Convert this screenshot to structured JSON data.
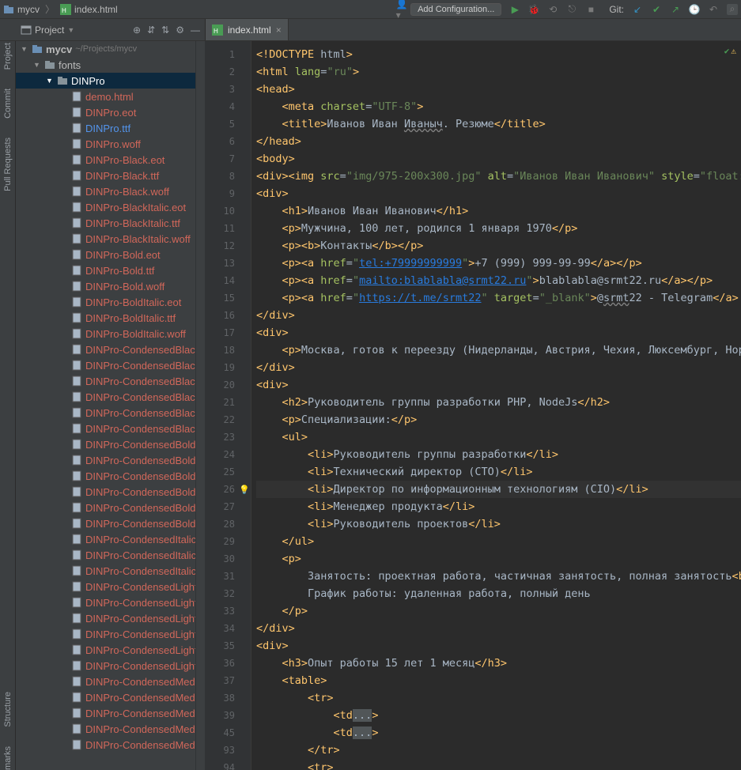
{
  "navbar": {
    "crumb1": "mycv",
    "crumb2": "index.html",
    "add_config": "Add Configuration...",
    "git_label": "Git:"
  },
  "toolwindow": {
    "project_label": "Project"
  },
  "rail": {
    "project": "Project",
    "commit": "Commit",
    "pull": "Pull Requests",
    "structure": "Structure",
    "marks": "marks"
  },
  "editor_tab": {
    "label": "index.html"
  },
  "tree": {
    "root_name": "mycv",
    "root_path": "~/Projects/mycv",
    "fonts": "fonts",
    "dinpro": "DINPro",
    "files": [
      {
        "name": "demo.html",
        "cls": "orange"
      },
      {
        "name": "DINPro.eot",
        "cls": "orange"
      },
      {
        "name": "DINPro.ttf",
        "cls": "blue"
      },
      {
        "name": "DINPro.woff",
        "cls": "orange"
      },
      {
        "name": "DINPro-Black.eot",
        "cls": "orange"
      },
      {
        "name": "DINPro-Black.ttf",
        "cls": "orange"
      },
      {
        "name": "DINPro-Black.woff",
        "cls": "orange"
      },
      {
        "name": "DINPro-BlackItalic.eot",
        "cls": "orange"
      },
      {
        "name": "DINPro-BlackItalic.ttf",
        "cls": "orange"
      },
      {
        "name": "DINPro-BlackItalic.woff",
        "cls": "orange"
      },
      {
        "name": "DINPro-Bold.eot",
        "cls": "orange"
      },
      {
        "name": "DINPro-Bold.ttf",
        "cls": "orange"
      },
      {
        "name": "DINPro-Bold.woff",
        "cls": "orange"
      },
      {
        "name": "DINPro-BoldItalic.eot",
        "cls": "orange"
      },
      {
        "name": "DINPro-BoldItalic.ttf",
        "cls": "orange"
      },
      {
        "name": "DINPro-BoldItalic.woff",
        "cls": "orange"
      },
      {
        "name": "DINPro-CondensedBlack.eot",
        "cls": "orange"
      },
      {
        "name": "DINPro-CondensedBlack.ttf",
        "cls": "orange"
      },
      {
        "name": "DINPro-CondensedBlack.woff",
        "cls": "orange"
      },
      {
        "name": "DINPro-CondensedBlackItalic.eot",
        "cls": "orange"
      },
      {
        "name": "DINPro-CondensedBlackItalic.ttf",
        "cls": "orange"
      },
      {
        "name": "DINPro-CondensedBlackItalic.woff",
        "cls": "orange"
      },
      {
        "name": "DINPro-CondensedBold.eot",
        "cls": "orange"
      },
      {
        "name": "DINPro-CondensedBold.ttf",
        "cls": "orange"
      },
      {
        "name": "DINPro-CondensedBold.woff",
        "cls": "orange"
      },
      {
        "name": "DINPro-CondensedBoldItalic.eot",
        "cls": "orange"
      },
      {
        "name": "DINPro-CondensedBoldItalic.ttf",
        "cls": "orange"
      },
      {
        "name": "DINPro-CondensedBoldItalic.woff",
        "cls": "orange"
      },
      {
        "name": "DINPro-CondensedItalic.eot",
        "cls": "orange"
      },
      {
        "name": "DINPro-CondensedItalic.ttf",
        "cls": "orange"
      },
      {
        "name": "DINPro-CondensedItalic.woff",
        "cls": "orange"
      },
      {
        "name": "DINPro-CondensedLight.eot",
        "cls": "orange"
      },
      {
        "name": "DINPro-CondensedLight.ttf",
        "cls": "orange"
      },
      {
        "name": "DINPro-CondensedLight.woff",
        "cls": "orange"
      },
      {
        "name": "DINPro-CondensedLightItalic.eot",
        "cls": "orange"
      },
      {
        "name": "DINPro-CondensedLightItalic.ttf",
        "cls": "orange"
      },
      {
        "name": "DINPro-CondensedLightItalic.woff",
        "cls": "orange"
      },
      {
        "name": "DINPro-CondensedMedium.eot",
        "cls": "orange"
      },
      {
        "name": "DINPro-CondensedMedium.ttf",
        "cls": "orange"
      },
      {
        "name": "DINPro-CondensedMedium.woff",
        "cls": "orange"
      },
      {
        "name": "DINPro-CondensedMediumItalic.eot",
        "cls": "orange"
      },
      {
        "name": "DINPro-CondensedMediumItalic.ttf",
        "cls": "orange"
      }
    ]
  },
  "gutter_lines": [
    "1",
    "2",
    "3",
    "4",
    "5",
    "6",
    "7",
    "8",
    "9",
    "10",
    "11",
    "12",
    "13",
    "14",
    "15",
    "16",
    "17",
    "18",
    "19",
    "20",
    "21",
    "22",
    "23",
    "24",
    "25",
    "26",
    "27",
    "28",
    "29",
    "30",
    "31",
    "32",
    "33",
    "34",
    "35",
    "36",
    "37",
    "38",
    "39",
    "45",
    "93",
    "94"
  ],
  "code": {
    "l1": {
      "a": "<!DOCTYPE ",
      "b": "html",
      "c": ">"
    },
    "l2": {
      "a": "<html ",
      "b": "lang",
      "c": "=",
      "d": "\"ru\"",
      "e": ">"
    },
    "l3": "<head>",
    "l4": {
      "a": "    <meta ",
      "b": "charset",
      "c": "=",
      "d": "\"UTF-8\"",
      "e": ">"
    },
    "l5": {
      "a": "    <title>",
      "b": "Иванов Иван ",
      "c": "Иваныч",
      "d": ". Резюме",
      "e": "</title>"
    },
    "l6": "</head>",
    "l7": "<body>",
    "l8": {
      "a": "<div><img ",
      "b": "src",
      "c": "=",
      "d": "\"img/975-200x300.jpg\"",
      "e": " alt",
      "f": "=",
      "g": "\"Иванов Иван Иванович\"",
      "h": " style",
      "i": "=",
      "j": "\"float: r"
    },
    "l9": "<div>",
    "l10": {
      "a": "    <h1>",
      "b": "Иванов Иван Иванович",
      "c": "</h1>"
    },
    "l11": {
      "a": "    <p>",
      "b": "Мужчина, 100 лет, родился 1 января 1970",
      "c": "</p>"
    },
    "l12": {
      "a": "    <p><b>",
      "b": "Контакты",
      "c": "</b></p>"
    },
    "l13": {
      "a": "    <p><a ",
      "b": "href",
      "c": "=",
      "d": "\"",
      "e": "tel:+79999999999",
      "f": "\"",
      "g": ">",
      "h": "+7 (999) 999-99-99",
      "i": "</a></p>"
    },
    "l14": {
      "a": "    <p><a ",
      "b": "href",
      "c": "=",
      "d": "\"",
      "e": "mailto:blablabla@srmt22.ru",
      "f": "\"",
      "g": ">",
      "h": "blablabla@srmt22.ru",
      "i": "</a></p>"
    },
    "l15": {
      "a": "    <p><a ",
      "b": "href",
      "c": "=",
      "d": "\"",
      "e": "https://t.me/srmt22",
      "f": "\"",
      "g": " target",
      "h": "=",
      "i": "\"_blank\"",
      "j": ">",
      "k": "@",
      "l": "srmt",
      "m": "22 - Telegram",
      "n": "</a>",
      "o": " - "
    },
    "l16": "</div>",
    "l17": "<div>",
    "l18": {
      "a": "    <p>",
      "b": "Москва, готов к переезду (Нидерланды, Австрия, Чехия, Люксембург, Норве"
    },
    "l19": "</div>",
    "l20": "<div>",
    "l21": {
      "a": "    <h2>",
      "b": "Руководитель группы разработки PHP, NodeJs",
      "c": "</h2>"
    },
    "l22": {
      "a": "    <p>",
      "b": "Специализации:",
      "c": "</p>"
    },
    "l23": "    <ul>",
    "l24": {
      "a": "        <li>",
      "b": "Руководитель группы разработки",
      "c": "</li>"
    },
    "l25": {
      "a": "        <li>",
      "b": "Технический директор (CTO)",
      "c": "</li>"
    },
    "l26": {
      "a": "        <li>",
      "b": "Директор по информационным технологиям (CIO)",
      "c": "</li>"
    },
    "l27": {
      "a": "        <li>",
      "b": "Менеджер продукта",
      "c": "</li>"
    },
    "l28": {
      "a": "        <li>",
      "b": "Руководитель проектов",
      "c": "</li>"
    },
    "l29": "    </ul>",
    "l30": "    <p>",
    "l31": "        Занятость: проектная работа, частичная занятость, полная занятость<br>",
    "l32": "        График работы: удаленная работа, полный день",
    "l33": "    </p>",
    "l34": "</div>",
    "l35": "<div>",
    "l36": {
      "a": "    <h3>",
      "b": "Опыт работы 15 лет 1 месяц",
      "c": "</h3>"
    },
    "l37": "    <table>",
    "l38": "        <tr>",
    "l39": {
      "a": "            <td",
      "b": "...",
      "c": ">"
    },
    "l45": {
      "a": "            <td",
      "b": "...",
      "c": ">"
    },
    "l93": "        </tr>",
    "l94": "        <tr>"
  }
}
